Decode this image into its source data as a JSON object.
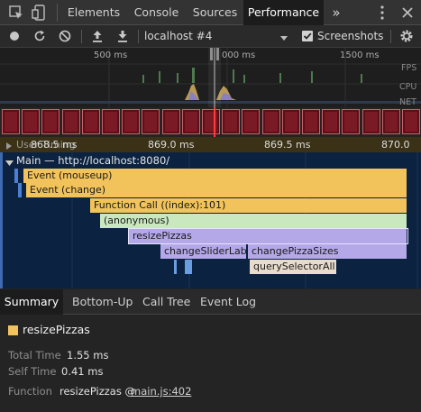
{
  "tabs": [
    "Elements",
    "Console",
    "Sources",
    "Performance"
  ],
  "active_tab": "Performance",
  "more_tabs_glyph": "»",
  "toolbar": {
    "profile_select": "localhost #4",
    "screenshots_label": "Screenshots",
    "screenshots_checked": true
  },
  "overview": {
    "time_marks": [
      "500 ms",
      "000 ms",
      "1500 ms"
    ],
    "track_labels": [
      "FPS",
      "CPU",
      "NET"
    ]
  },
  "ruler": {
    "timings_label": "User Timing",
    "marks": [
      "868.5 ms",
      "869.0 ms",
      "869.5 ms",
      "870.0"
    ]
  },
  "flame": {
    "main_title": "Main — http://localhost:8080/",
    "entries": [
      "Event (mouseup)",
      "Event (change)",
      "Function Call ((index):101)",
      "(anonymous)",
      "resizePizzas",
      "changeSliderLabel",
      "changePizzaSizes",
      "querySelectorAll"
    ]
  },
  "bottom_tabs": [
    "Summary",
    "Bottom-Up",
    "Call Tree",
    "Event Log"
  ],
  "active_bottom_tab": "Summary",
  "summary": {
    "title": "resizePizzas",
    "total_time_label": "Total Time",
    "total_time": "1.55 ms",
    "self_time_label": "Self Time",
    "self_time": "0.41 ms",
    "function_label": "Function",
    "function_name": "resizePizzas @",
    "function_link": "main.js:402"
  },
  "colors": {
    "scripting_yellow": "#f2c35a",
    "selected_purple": "#b4a8e8",
    "anonymous_green": "#c9e8c0",
    "flame_bg": "#0b2240"
  }
}
